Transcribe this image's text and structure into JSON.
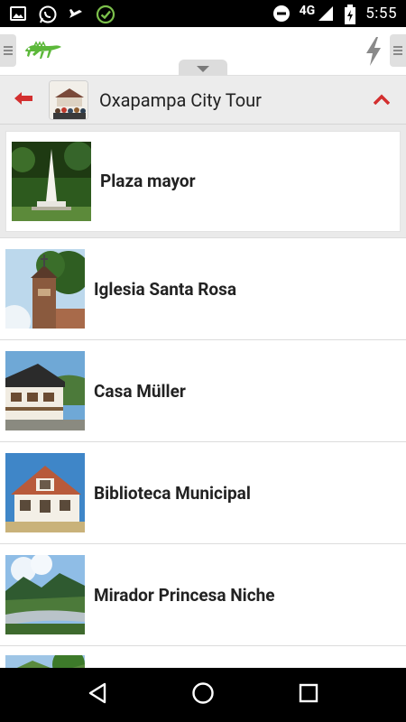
{
  "status_bar": {
    "left_icons": [
      "image-icon",
      "whatsapp-icon",
      "airplane-like-icon",
      "check-circle-icon"
    ],
    "right_icons": [
      "do-not-disturb-icon",
      "signal-icon",
      "battery-charging-icon"
    ],
    "network": "4G",
    "time": "5:55"
  },
  "toolbar": {
    "left_handle_icon": "menu-handle-icon",
    "logo_icon": "iguana-logo-icon",
    "right_icon": "lightning-icon",
    "right_handle_icon": "menu-handle-icon",
    "pull_tab_icon": "chevron-down-icon"
  },
  "titlebar": {
    "back_icon": "back-arrow-icon",
    "title": "Oxapampa City Tour",
    "collapse_icon": "chevron-up-icon"
  },
  "list": {
    "items": [
      {
        "label": "Plaza mayor",
        "selected": true
      },
      {
        "label": "Iglesia Santa Rosa",
        "selected": false
      },
      {
        "label": "Casa Müller",
        "selected": false
      },
      {
        "label": "Biblioteca Municipal",
        "selected": false
      },
      {
        "label": "Mirador Princesa Niche",
        "selected": false
      },
      {
        "label": "",
        "selected": false
      }
    ]
  },
  "navbar": {
    "back_icon": "nav-back-icon",
    "home_icon": "nav-home-icon",
    "recents_icon": "nav-recents-icon"
  },
  "colors": {
    "accent_red": "#d32f2f",
    "logo_green": "#4caf50",
    "titlebar_bg": "#ececec"
  }
}
